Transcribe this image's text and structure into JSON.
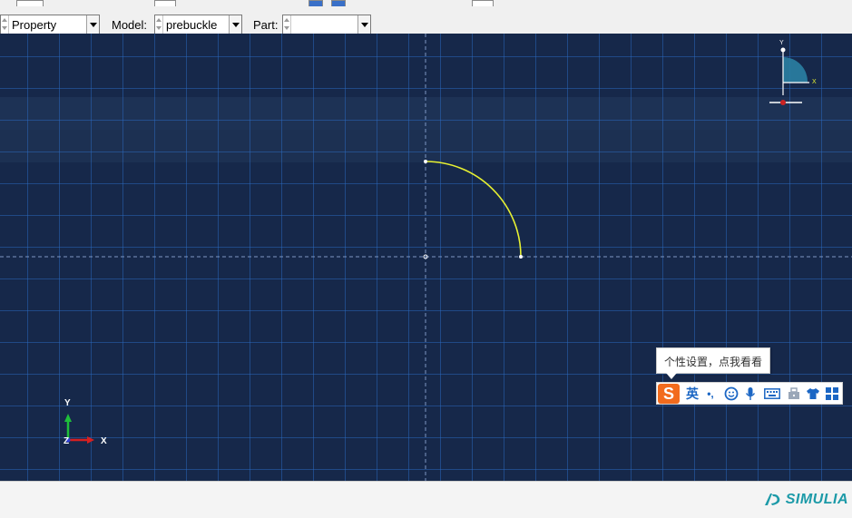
{
  "toolbar": {
    "module_value": "Property",
    "model_label": "Model:",
    "model_value": "prebuckle",
    "part_label": "Part:",
    "part_value": ""
  },
  "viewport": {
    "background": "#16284a",
    "grid_color": "#2f76d6",
    "arc_color": "#e6f032",
    "triad": {
      "y_label": "Y",
      "z_label": "Z",
      "x_label": "X"
    },
    "sketch_axes": {
      "y_label": "Y",
      "x_label": "X"
    }
  },
  "ime": {
    "tooltip": "个性设置，点我看看",
    "lang_label": "英",
    "punct_label": "•,"
  },
  "footer": {
    "brand": "SIMULIA",
    "brand_color": "#1c9aa8"
  }
}
